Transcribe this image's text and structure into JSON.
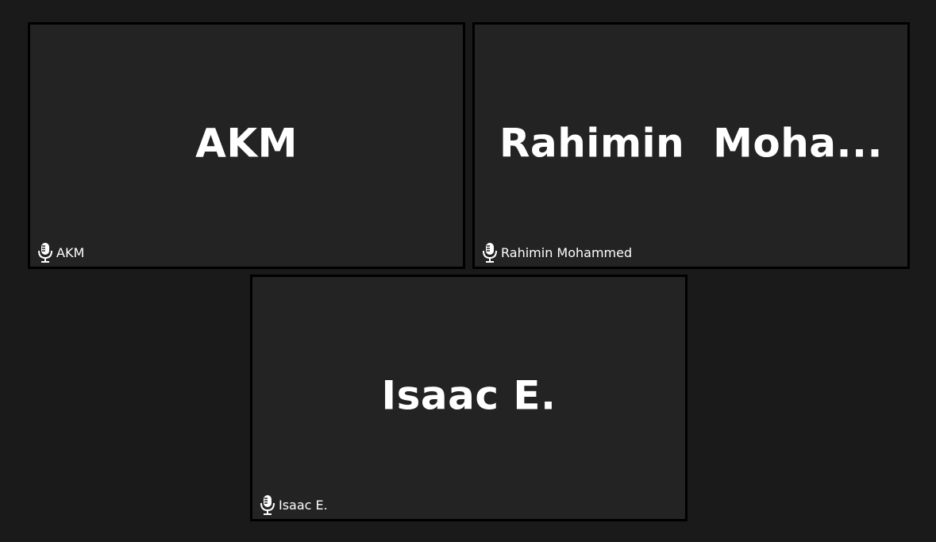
{
  "participants": [
    {
      "display_name": "AKM",
      "nameplate": "AKM",
      "mic_icon": "microphone-icon"
    },
    {
      "display_name": "Rahimin  Moha...",
      "nameplate": "Rahimin Mohammed",
      "mic_icon": "microphone-icon"
    },
    {
      "display_name": "Isaac E.",
      "nameplate": "Isaac E.",
      "mic_icon": "microphone-icon"
    }
  ],
  "colors": {
    "background": "#1a1a1a",
    "tile": "#232323",
    "tile_border": "#000000",
    "text": "#ffffff"
  }
}
